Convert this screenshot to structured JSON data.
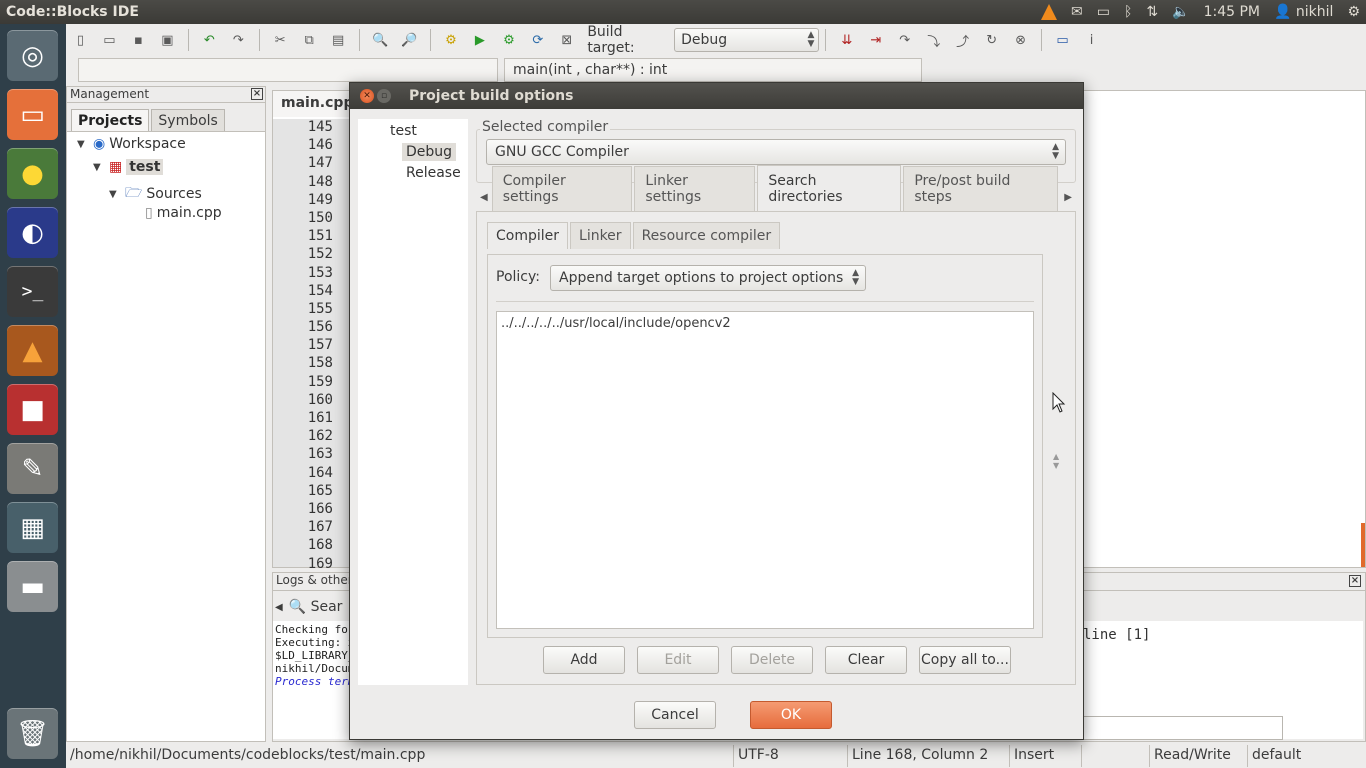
{
  "top_panel": {
    "app_title": "Code::Blocks IDE",
    "time": "1:45 PM",
    "user": "nikhil"
  },
  "toolbar": {
    "build_target_label": "Build target:",
    "build_target_value": "Debug",
    "function_combo": "main(int , char**) : int"
  },
  "management": {
    "header": "Management",
    "tabs": [
      "Projects",
      "Symbols"
    ],
    "tree": {
      "workspace": "Workspace",
      "project": "test",
      "folder": "Sources",
      "file": "main.cpp"
    }
  },
  "editor": {
    "tab": "main.cpp",
    "line_numbers": [
      "145",
      "146",
      "147",
      "148",
      "149",
      "150",
      "151",
      "152",
      "153",
      "154",
      "155",
      "156",
      "157",
      "158",
      "159",
      "160",
      "161",
      "162",
      "163",
      "164",
      "165",
      "166",
      "167",
      "168",
      "169"
    ]
  },
  "logs": {
    "header": "Logs & others",
    "tab": "Sear",
    "lines": [
      "Checking for",
      "Executing: x",
      "$LD_LIBRARY_",
      "nikhil/Docum"
    ],
    "italic_line": "Process term",
    "right_text": "line [1]"
  },
  "status_bar": {
    "path": "/home/nikhil/Documents/codeblocks/test/main.cpp",
    "encoding": "UTF-8",
    "position": "Line 168, Column 2",
    "mode": "Insert",
    "access": "Read/Write",
    "profile": "default"
  },
  "dialog": {
    "title": "Project build options",
    "targets": [
      "test",
      "Debug",
      "Release"
    ],
    "selected_compiler_label": "Selected compiler",
    "compiler": "GNU GCC Compiler",
    "tabs": [
      "Compiler settings",
      "Linker settings",
      "Search directories",
      "Pre/post build steps"
    ],
    "subtabs": [
      "Compiler",
      "Linker",
      "Resource compiler"
    ],
    "policy_label": "Policy:",
    "policy_value": "Append target options to project options",
    "directories": [
      "../../../../../usr/local/include/opencv2"
    ],
    "buttons": {
      "add": "Add",
      "edit": "Edit",
      "delete": "Delete",
      "clear": "Clear",
      "copy_all": "Copy all to..."
    },
    "cancel": "Cancel",
    "ok": "OK"
  },
  "colors": {
    "accent": "#e66c3d",
    "panel_dark": "#3b3a36",
    "launcher": "#2f3f49"
  }
}
